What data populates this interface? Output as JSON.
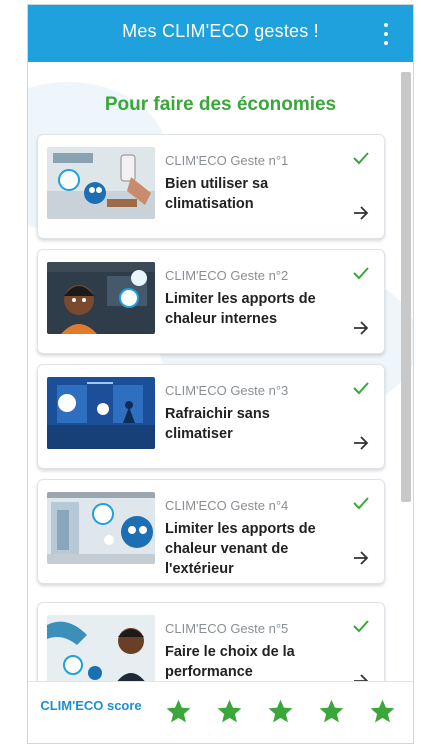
{
  "appbar": {
    "title": "Mes CLIM'ECO gestes !",
    "menu_icon": "more-vertical-icon"
  },
  "section_title": "Pour faire des économies",
  "gestures": [
    {
      "subtitle": "CLIM'ECO Geste n°1",
      "title": "Bien utiliser sa climatisation",
      "completed": true
    },
    {
      "subtitle": "CLIM'ECO Geste n°2",
      "title": "Limiter les apports de chaleur internes",
      "completed": true
    },
    {
      "subtitle": "CLIM'ECO Geste n°3",
      "title": "Rafraichir sans climatiser",
      "completed": true
    },
    {
      "subtitle": "CLIM'ECO Geste n°4",
      "title": "Limiter les apports de chaleur venant de l'extérieur",
      "completed": true
    },
    {
      "subtitle": "CLIM'ECO Geste n°5",
      "title": "Faire le choix de la performance",
      "completed": true
    }
  ],
  "footer": {
    "score_label": "CLIM'ECO score",
    "stars_filled": 5,
    "stars_total": 5
  },
  "colors": {
    "accent": "#1ea1dc",
    "green": "#3aa73a",
    "score_blue": "#1e8fd0"
  }
}
